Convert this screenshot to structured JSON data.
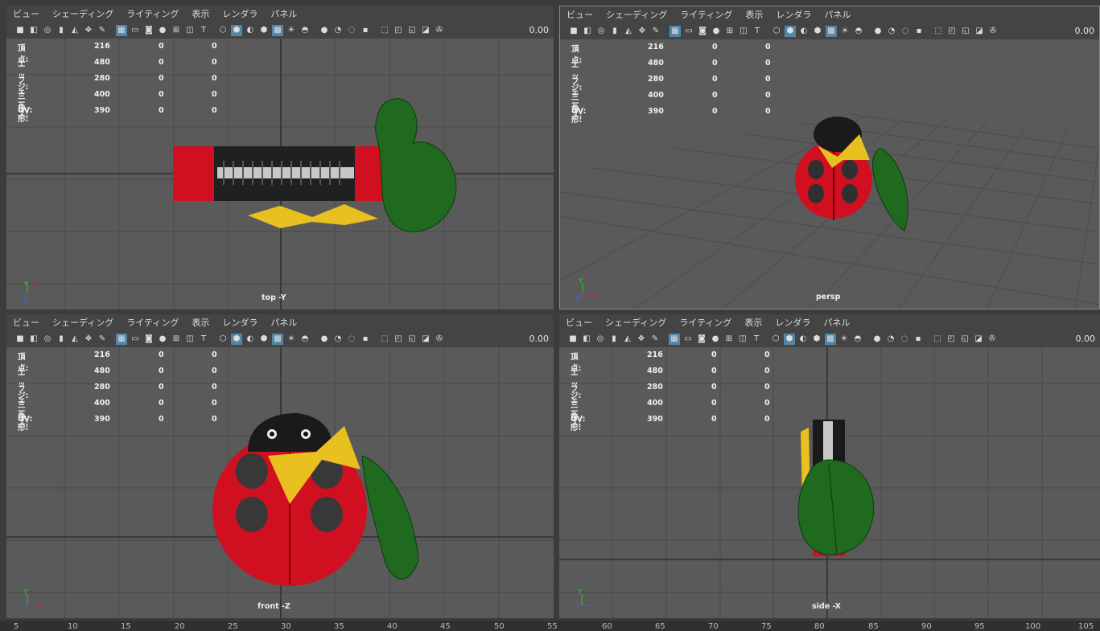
{
  "menu": [
    "ビュー",
    "シェーディング",
    "ライティング",
    "表示",
    "レンダラ",
    "パネル"
  ],
  "zoom_value": "0.00",
  "hud": {
    "labels": [
      "頂点:",
      "エッジ:",
      "フェース:",
      "三角形:",
      "UV:"
    ],
    "col1": [
      "216",
      "480",
      "280",
      "400",
      "390"
    ],
    "col2": [
      "0",
      "0",
      "0",
      "0",
      "0"
    ],
    "col3": [
      "0",
      "0",
      "0",
      "0",
      "0"
    ]
  },
  "panes": {
    "top": {
      "camera": "top -Y",
      "axis": [
        "Y",
        "X",
        "Z"
      ]
    },
    "persp": {
      "camera": "persp",
      "axis": [
        "Y",
        "X",
        "Z"
      ]
    },
    "front": {
      "camera": "front -Z",
      "axis": [
        "Y",
        "X",
        "Z"
      ]
    },
    "side": {
      "camera": "side -X",
      "axis": [
        "Y",
        "Z"
      ]
    }
  },
  "ruler": [
    "5",
    "10",
    "15",
    "20",
    "25",
    "30",
    "35",
    "40",
    "45",
    "50",
    "55",
    "60",
    "65",
    "70",
    "75",
    "80",
    "85",
    "90",
    "95",
    "100",
    "105"
  ],
  "colors": {
    "viewport_bg": "#5a5a5a",
    "menubar": "#444444",
    "selected": "#5285a6",
    "ladybug_red": "#d01020",
    "leaf_green": "#1f6a1f",
    "bow_yellow": "#e8c020"
  }
}
